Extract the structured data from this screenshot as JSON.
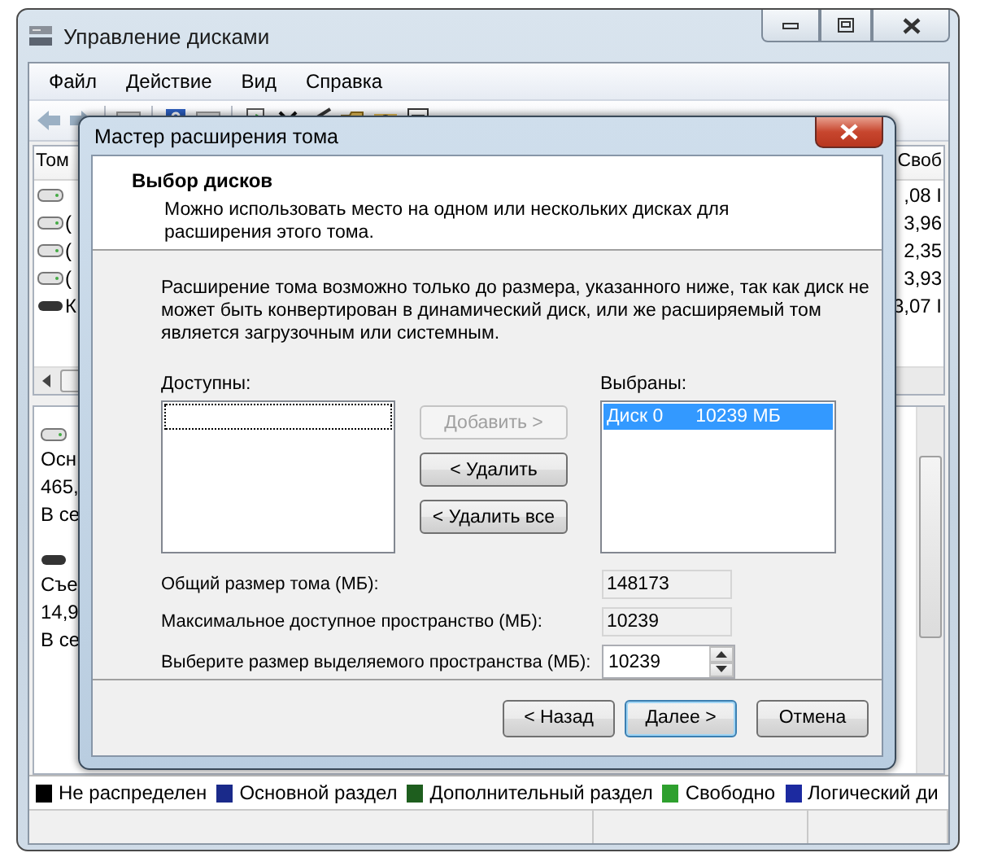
{
  "window": {
    "title": "Управление дисками"
  },
  "menu": [
    {
      "label": "Файл"
    },
    {
      "label": "Действие"
    },
    {
      "label": "Вид"
    },
    {
      "label": "Справка"
    }
  ],
  "volume_table": {
    "columns": [
      "Том",
      "Своб"
    ],
    "rows": [
      {
        "kind": "hdd",
        "volume": "",
        "free": ",08 I"
      },
      {
        "kind": "hdd",
        "volume": "(",
        "free": "3,96"
      },
      {
        "kind": "hdd",
        "volume": "(",
        "free": "2,35"
      },
      {
        "kind": "hdd",
        "volume": "(",
        "free": "3,93"
      },
      {
        "kind": "removable",
        "volume": "К",
        "free": "3,07 I"
      }
    ]
  },
  "disks": [
    {
      "kind": "hdd",
      "lines": [
        "Осн",
        "465,",
        "В се"
      ]
    },
    {
      "kind": "removable",
      "lines": [
        "Съе",
        "14,9",
        "В се"
      ]
    }
  ],
  "legend": [
    {
      "label": "Не распределен",
      "color": "#000000"
    },
    {
      "label": "Основной раздел",
      "color": "#1a2a8a"
    },
    {
      "label": "Дополнительный раздел",
      "color": "#1e5e1e"
    },
    {
      "label": "Свободно",
      "color": "#2ea02e"
    },
    {
      "label": "Логический ди",
      "color": "#1c2aa0"
    }
  ],
  "dialog": {
    "title": "Мастер расширения тома",
    "heading": "Выбор дисков",
    "subheading": "Можно использовать место на одном или нескольких дисках для расширения этого тома.",
    "note": "Расширение тома возможно только до размера, указанного ниже, так как диск не может быть конвертирован в динамический диск, или же расширяемый том является загрузочным или системным.",
    "available": {
      "label": "Доступны:"
    },
    "chosen": {
      "label": "Выбраны:",
      "items": [
        {
          "disk": "Диск 0",
          "size": "10239 МБ",
          "selected": true
        }
      ]
    },
    "move_buttons": [
      {
        "label": "Добавить >",
        "disabled": true
      },
      {
        "label": "< Удалить",
        "disabled": false
      },
      {
        "label": "< Удалить все",
        "disabled": false
      }
    ],
    "fields": [
      {
        "kind": "readonly",
        "label": "Общий размер тома (МБ):",
        "value": "148173"
      },
      {
        "kind": "readonly",
        "label": "Максимальное доступное пространство (МБ):",
        "value": "10239"
      },
      {
        "kind": "spinner",
        "label": "Выберите размер выделяемого пространства (МБ):",
        "value": "10239"
      }
    ],
    "buttons": [
      {
        "label": "< Назад",
        "default": false
      },
      {
        "label": "Далее >",
        "default": true
      },
      {
        "label": "Отмена",
        "default": false
      }
    ]
  }
}
